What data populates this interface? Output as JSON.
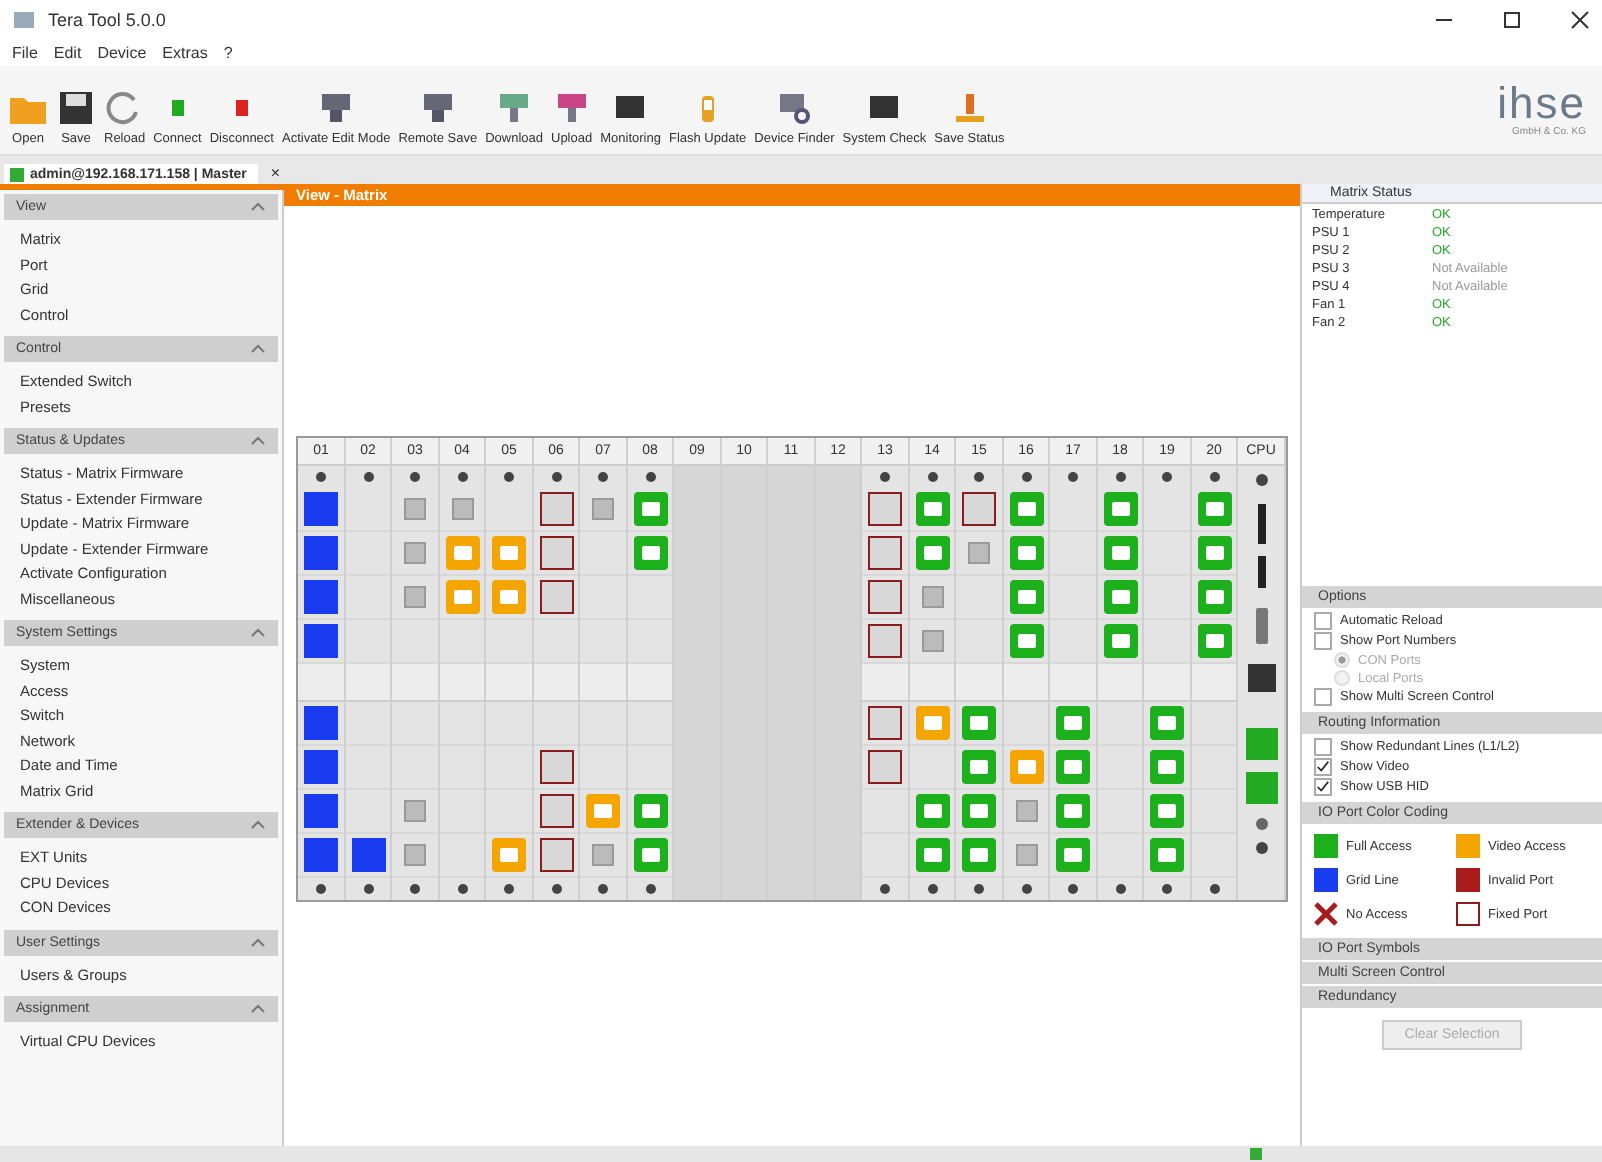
{
  "window": {
    "title": "Tera Tool 5.0.0"
  },
  "menu": [
    "File",
    "Edit",
    "Device",
    "Extras",
    "?"
  ],
  "toolbar": [
    "Open",
    "Save",
    "Reload",
    "Connect",
    "Disconnect",
    "Activate Edit Mode",
    "Remote Save",
    "Download",
    "Upload",
    "Monitoring",
    "Flash Update",
    "Device Finder",
    "System Check",
    "Save Status"
  ],
  "logo": {
    "name": "ihse",
    "tagline": "GmbH & Co. KG"
  },
  "tab": {
    "label": "admin@192.168.171.158 | Master",
    "close": "×"
  },
  "sidebar": [
    {
      "title": "View",
      "items": [
        "Matrix",
        "Port",
        "Grid",
        "Control"
      ]
    },
    {
      "title": "Control",
      "items": [
        "Extended Switch",
        "Presets"
      ]
    },
    {
      "title": "Status & Updates",
      "items": [
        "Status - Matrix Firmware",
        "Status - Extender Firmware",
        "Update - Matrix Firmware",
        "Update - Extender Firmware",
        "Activate Configuration",
        "Miscellaneous"
      ]
    },
    {
      "title": "System Settings",
      "items": [
        "System",
        "Access",
        "Switch",
        "Network",
        "Date and Time",
        "Matrix Grid"
      ]
    },
    {
      "title": "Extender & Devices",
      "items": [
        "EXT Units",
        "CPU Devices",
        "CON Devices"
      ]
    },
    {
      "title": "User Settings",
      "items": [
        "Users & Groups"
      ]
    },
    {
      "title": "Assignment",
      "items": [
        "Virtual CPU Devices"
      ]
    }
  ],
  "view_title": "View - Matrix",
  "matrix": {
    "columns": [
      {
        "label": "01",
        "kind": "io",
        "ports": [
          {
            "kind": "grid"
          },
          {
            "kind": "grid"
          },
          {
            "kind": "grid"
          },
          {
            "kind": "grid"
          },
          {
            "kind": "grid"
          },
          {
            "kind": "grid"
          },
          {
            "kind": "grid"
          },
          {
            "kind": "grid"
          }
        ]
      },
      {
        "label": "02",
        "kind": "io",
        "ports": [
          {
            "kind": "empty"
          },
          {
            "kind": "empty"
          },
          {
            "kind": "empty"
          },
          {
            "kind": "empty"
          },
          {
            "kind": "empty"
          },
          {
            "kind": "empty"
          },
          {
            "kind": "empty"
          },
          {
            "kind": "grid"
          }
        ]
      },
      {
        "label": "03",
        "kind": "io",
        "ports": [
          {
            "kind": "idle"
          },
          {
            "kind": "idle"
          },
          {
            "kind": "idle"
          },
          {
            "kind": "empty"
          },
          {
            "kind": "empty"
          },
          {
            "kind": "empty"
          },
          {
            "kind": "idle"
          },
          {
            "kind": "idle"
          }
        ]
      },
      {
        "label": "04",
        "kind": "io",
        "ports": [
          {
            "kind": "idle"
          },
          {
            "kind": "video"
          },
          {
            "kind": "video"
          },
          {
            "kind": "empty"
          },
          {
            "kind": "empty"
          },
          {
            "kind": "empty"
          },
          {
            "kind": "empty"
          },
          {
            "kind": "empty"
          }
        ]
      },
      {
        "label": "05",
        "kind": "io",
        "ports": [
          {
            "kind": "empty"
          },
          {
            "kind": "video"
          },
          {
            "kind": "video"
          },
          {
            "kind": "empty"
          },
          {
            "kind": "empty"
          },
          {
            "kind": "empty"
          },
          {
            "kind": "empty"
          },
          {
            "kind": "video"
          }
        ]
      },
      {
        "label": "06",
        "kind": "io",
        "ports": [
          {
            "kind": "fixed"
          },
          {
            "kind": "fixed"
          },
          {
            "kind": "fixed"
          },
          {
            "kind": "empty"
          },
          {
            "kind": "empty"
          },
          {
            "kind": "fixed"
          },
          {
            "kind": "fixed"
          },
          {
            "kind": "fixed"
          }
        ]
      },
      {
        "label": "07",
        "kind": "io",
        "ports": [
          {
            "kind": "idle"
          },
          {
            "kind": "empty"
          },
          {
            "kind": "empty"
          },
          {
            "kind": "empty"
          },
          {
            "kind": "empty"
          },
          {
            "kind": "empty"
          },
          {
            "kind": "video"
          },
          {
            "kind": "idle"
          }
        ]
      },
      {
        "label": "08",
        "kind": "io",
        "ports": [
          {
            "kind": "full"
          },
          {
            "kind": "full"
          },
          {
            "kind": "empty"
          },
          {
            "kind": "empty"
          },
          {
            "kind": "empty"
          },
          {
            "kind": "empty"
          },
          {
            "kind": "full"
          },
          {
            "kind": "full"
          }
        ]
      },
      {
        "label": "09",
        "kind": "empty"
      },
      {
        "label": "10",
        "kind": "empty"
      },
      {
        "label": "11",
        "kind": "empty"
      },
      {
        "label": "12",
        "kind": "empty"
      },
      {
        "label": "13",
        "kind": "io",
        "ports": [
          {
            "kind": "fixed"
          },
          {
            "kind": "fixed"
          },
          {
            "kind": "fixed"
          },
          {
            "kind": "fixed"
          },
          {
            "kind": "fixed"
          },
          {
            "kind": "fixed"
          },
          {
            "kind": "empty"
          },
          {
            "kind": "empty"
          }
        ]
      },
      {
        "label": "14",
        "kind": "io",
        "ports": [
          {
            "kind": "full"
          },
          {
            "kind": "full"
          },
          {
            "kind": "idle"
          },
          {
            "kind": "idle"
          },
          {
            "kind": "video"
          },
          {
            "kind": "empty"
          },
          {
            "kind": "full"
          },
          {
            "kind": "full"
          }
        ]
      },
      {
        "label": "15",
        "kind": "io",
        "ports": [
          {
            "kind": "fixed"
          },
          {
            "kind": "idle"
          },
          {
            "kind": "empty"
          },
          {
            "kind": "empty"
          },
          {
            "kind": "full"
          },
          {
            "kind": "full"
          },
          {
            "kind": "full"
          },
          {
            "kind": "full"
          }
        ]
      },
      {
        "label": "16",
        "kind": "io",
        "ports": [
          {
            "kind": "full"
          },
          {
            "kind": "full"
          },
          {
            "kind": "full"
          },
          {
            "kind": "full"
          },
          {
            "kind": "empty"
          },
          {
            "kind": "video"
          },
          {
            "kind": "idle"
          },
          {
            "kind": "idle"
          }
        ]
      },
      {
        "label": "17",
        "kind": "io",
        "ports": [
          {
            "kind": "empty"
          },
          {
            "kind": "empty"
          },
          {
            "kind": "empty"
          },
          {
            "kind": "empty"
          },
          {
            "kind": "full"
          },
          {
            "kind": "full"
          },
          {
            "kind": "full"
          },
          {
            "kind": "full"
          }
        ]
      },
      {
        "label": "18",
        "kind": "io",
        "ports": [
          {
            "kind": "full"
          },
          {
            "kind": "full"
          },
          {
            "kind": "full"
          },
          {
            "kind": "full"
          },
          {
            "kind": "empty"
          },
          {
            "kind": "empty"
          },
          {
            "kind": "empty"
          },
          {
            "kind": "empty"
          }
        ]
      },
      {
        "label": "19",
        "kind": "io",
        "ports": [
          {
            "kind": "empty"
          },
          {
            "kind": "empty"
          },
          {
            "kind": "empty"
          },
          {
            "kind": "empty"
          },
          {
            "kind": "full"
          },
          {
            "kind": "full"
          },
          {
            "kind": "full"
          },
          {
            "kind": "full"
          }
        ]
      },
      {
        "label": "20",
        "kind": "io",
        "ports": [
          {
            "kind": "full"
          },
          {
            "kind": "full"
          },
          {
            "kind": "full"
          },
          {
            "kind": "full"
          },
          {
            "kind": "empty"
          },
          {
            "kind": "empty"
          },
          {
            "kind": "empty"
          },
          {
            "kind": "empty"
          }
        ]
      },
      {
        "label": "CPU",
        "kind": "cpu"
      }
    ]
  },
  "matrix_status": {
    "title": "Matrix Status",
    "rows": [
      {
        "name": "Temperature",
        "value": "OK",
        "ok": true
      },
      {
        "name": "PSU 1",
        "value": "OK",
        "ok": true
      },
      {
        "name": "PSU 2",
        "value": "OK",
        "ok": true
      },
      {
        "name": "PSU 3",
        "value": "Not Available",
        "ok": false
      },
      {
        "name": "PSU 4",
        "value": "Not Available",
        "ok": false
      },
      {
        "name": "Fan 1",
        "value": "OK",
        "ok": true
      },
      {
        "name": "Fan 2",
        "value": "OK",
        "ok": true
      }
    ]
  },
  "options": {
    "title": "Options",
    "items": [
      {
        "kind": "check",
        "label": "Automatic Reload",
        "checked": false
      },
      {
        "kind": "check",
        "label": "Show Port Numbers",
        "checked": false
      },
      {
        "kind": "radio",
        "label": "CON Ports",
        "selected": true,
        "disabled": true
      },
      {
        "kind": "radio",
        "label": "Local Ports",
        "selected": false,
        "disabled": true
      },
      {
        "kind": "check",
        "label": "Show Multi Screen Control",
        "checked": false
      }
    ]
  },
  "routing": {
    "title": "Routing Information",
    "items": [
      {
        "label": "Show Redundant Lines (L1/L2)",
        "checked": false
      },
      {
        "label": "Show Video",
        "checked": true
      },
      {
        "label": "Show USB HID",
        "checked": true
      }
    ]
  },
  "legend": {
    "title": "IO Port Color Coding",
    "items": [
      {
        "kind": "swatch",
        "label": "Full Access",
        "color": "#1cb01c"
      },
      {
        "kind": "swatch",
        "label": "Video Access",
        "color": "#f5a500"
      },
      {
        "kind": "swatch",
        "label": "Grid Line",
        "color": "#1a3cf0"
      },
      {
        "kind": "swatch",
        "label": "Invalid Port",
        "color": "#a81c1c"
      },
      {
        "kind": "cross",
        "label": "No Access",
        "color": "#a81c1c"
      },
      {
        "kind": "outline",
        "label": "Fixed Port",
        "color": "#8a1c1c"
      }
    ]
  },
  "collapsed": [
    "IO Port Symbols",
    "Multi Screen Control",
    "Redundancy"
  ],
  "clear_button": {
    "label": "Clear Selection",
    "disabled": true
  }
}
